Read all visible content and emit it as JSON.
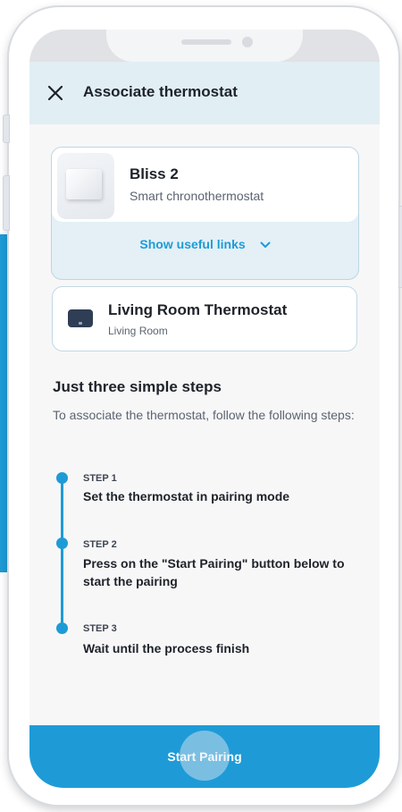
{
  "header": {
    "title": "Associate thermostat"
  },
  "device": {
    "name": "Bliss 2",
    "type": "Smart chronothermostat",
    "links_label": "Show useful links"
  },
  "room": {
    "name": "Living Room Thermostat",
    "location": "Living Room"
  },
  "steps": {
    "title": "Just three simple steps",
    "description": "To associate the thermostat, follow the following steps:",
    "items": [
      {
        "label": "STEP 1",
        "text": "Set the thermostat in pairing mode"
      },
      {
        "label": "STEP 2",
        "text": "Press on the \"Start Pairing\" button below to start the pairing"
      },
      {
        "label": "STEP 3",
        "text": "Wait until the process finish"
      }
    ]
  },
  "action": {
    "start_label": "Start Pairing"
  },
  "colors": {
    "accent": "#1e9bd7",
    "header_bg": "#e1eef4",
    "text": "#1e2229"
  }
}
